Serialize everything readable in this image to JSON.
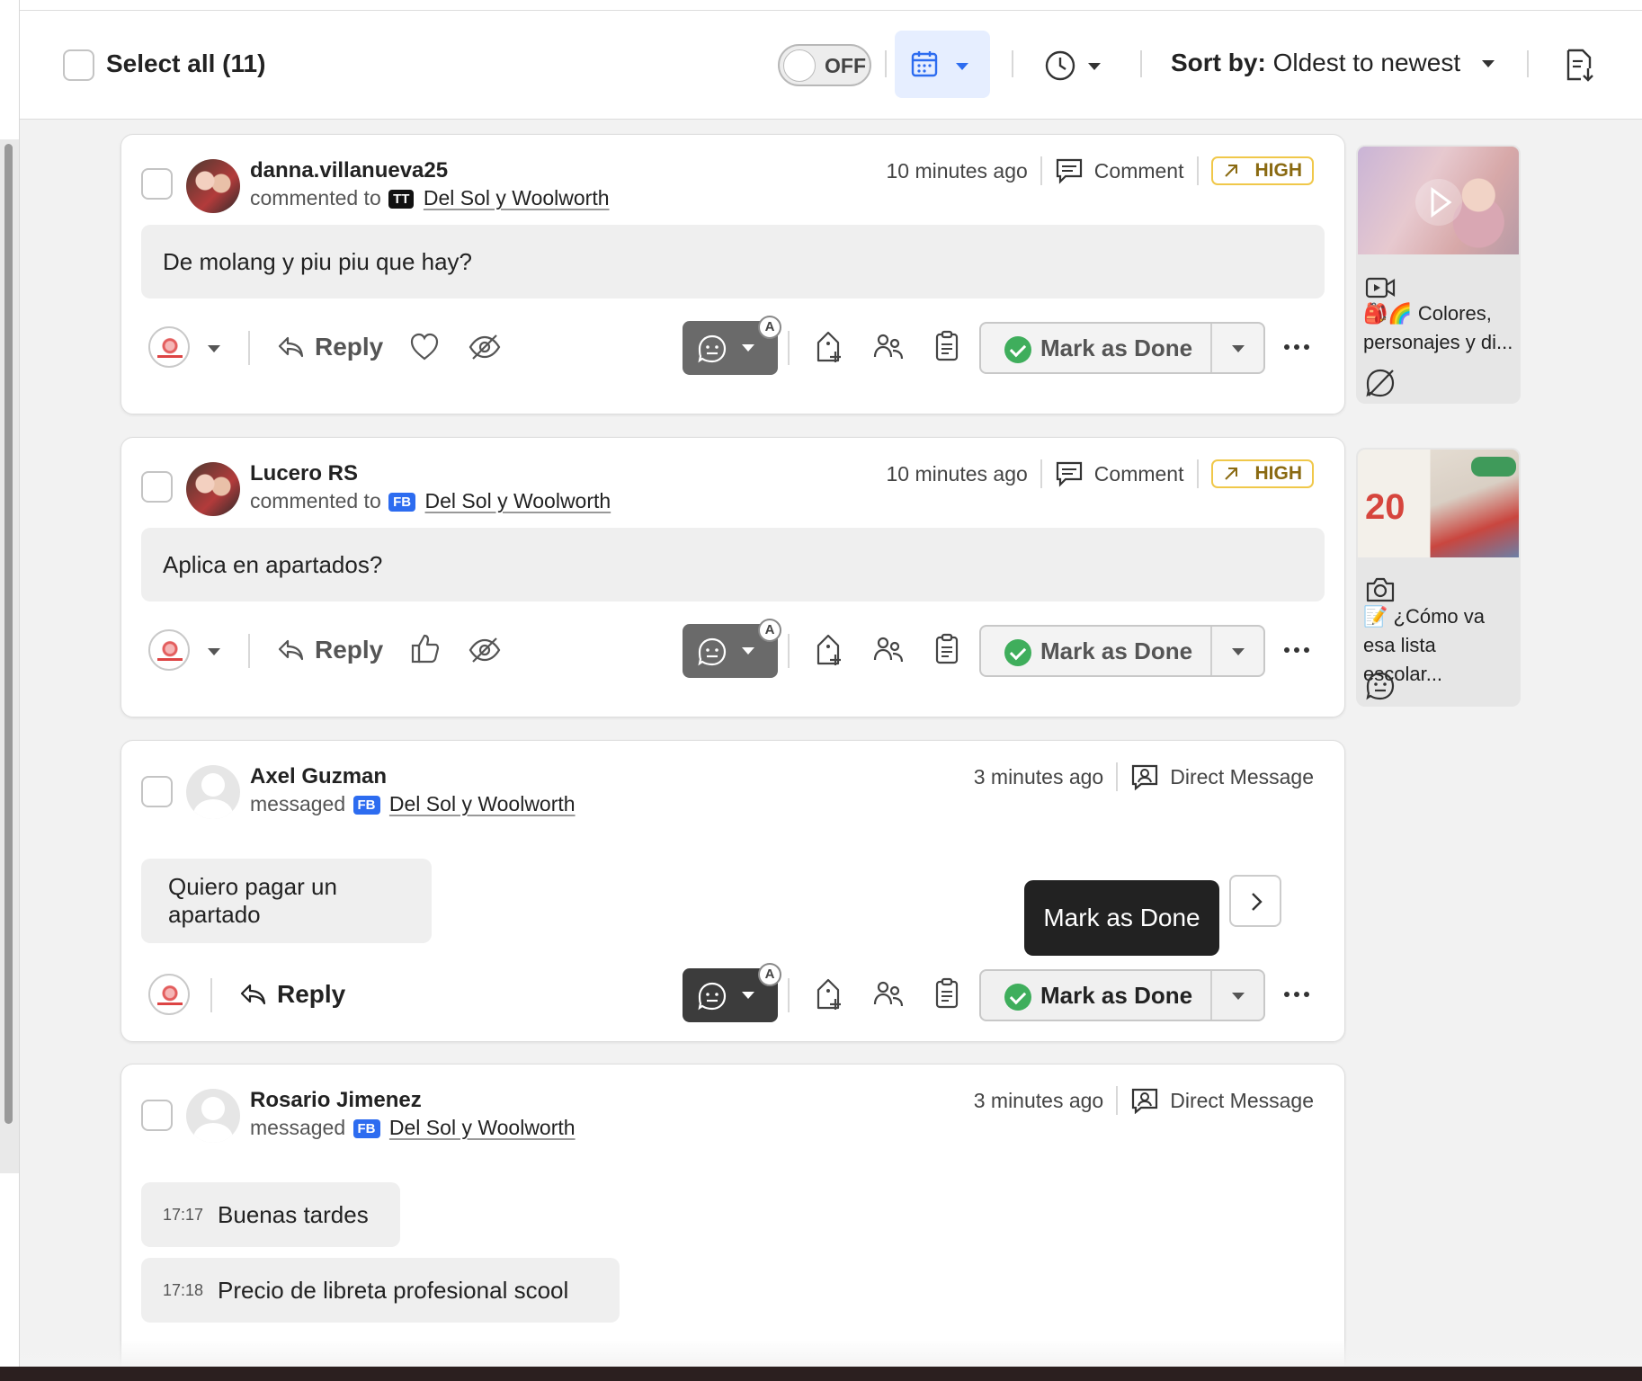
{
  "toolbar": {
    "select_all": "Select all (11)",
    "toggle_label": "OFF",
    "sort_prefix": "Sort by:",
    "sort_value": "Oldest to newest"
  },
  "cards": [
    {
      "username": "danna.villanueva25",
      "action": "commented to",
      "platform": "TT",
      "page": "Del Sol y Woolworth",
      "time": "10 minutes ago",
      "type": "Comment",
      "priority": "HIGH",
      "messages": [
        {
          "time": "",
          "text": "De molang y piu piu que hay?"
        }
      ],
      "reply": "Reply",
      "mark_done": "Mark as Done"
    },
    {
      "username": "Lucero RS",
      "action": "commented to",
      "platform": "FB",
      "page": "Del Sol y Woolworth",
      "time": "10 minutes ago",
      "type": "Comment",
      "priority": "HIGH",
      "messages": [
        {
          "time": "",
          "text": "Aplica en apartados?"
        }
      ],
      "reply": "Reply",
      "mark_done": "Mark as Done"
    },
    {
      "username": "Axel Guzman",
      "action": "messaged",
      "platform": "FB",
      "page": "Del Sol y Woolworth",
      "time": "3 minutes ago",
      "type": "Direct Message",
      "messages": [
        {
          "time": "",
          "text": "Quiero pagar un apartado"
        }
      ],
      "reply": "Reply",
      "mark_done": "Mark as Done",
      "tooltip": "Mark as Done"
    },
    {
      "username": "Rosario Jimenez",
      "action": "messaged",
      "platform": "FB",
      "page": "Del Sol y Woolworth",
      "time": "3 minutes ago",
      "type": "Direct Message",
      "messages": [
        {
          "time": "17:17",
          "text": "Buenas tardes"
        },
        {
          "time": "17:18",
          "text": "Precio de libreta profesional scool"
        }
      ]
    }
  ],
  "previews": [
    {
      "media_icon": "video-icon",
      "text": "🎒🌈 Colores, personajes y di..."
    },
    {
      "media_icon": "camera-icon",
      "text": "📝 ¿Cómo va esa lista escolar..."
    }
  ],
  "colors": {
    "accent_blue": "#2d6cf0",
    "high_border": "#f0c84a",
    "done_green": "#3fae5c"
  }
}
